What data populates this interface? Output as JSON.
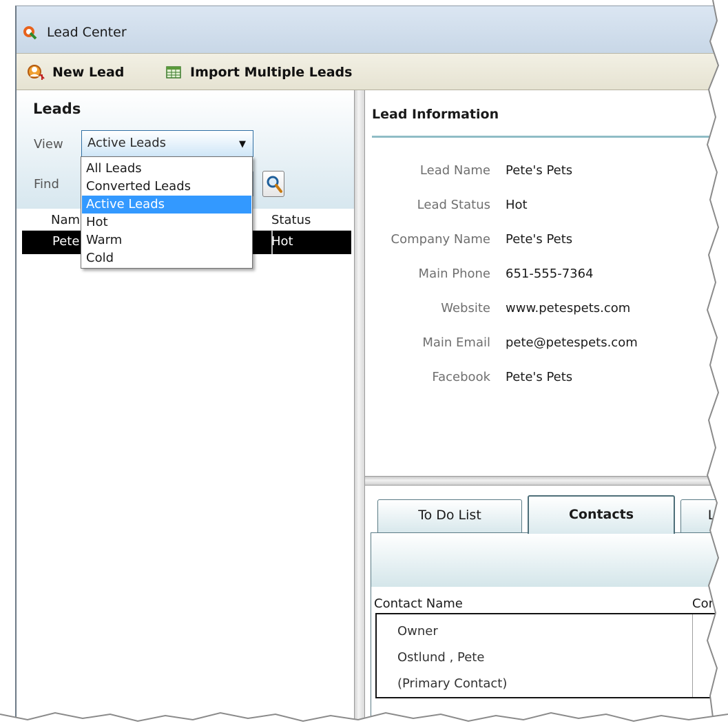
{
  "window": {
    "title": "Lead Center"
  },
  "toolbar": {
    "new_lead_label": "New Lead",
    "new_lead_icon": "new-lead-icon",
    "import_label": "Import Multiple Leads",
    "import_icon": "spreadsheet-icon"
  },
  "leads_panel": {
    "title": "Leads",
    "view_label": "View",
    "view_selected": "Active Leads",
    "find_label": "Find",
    "find_value": "",
    "dropdown_options": [
      "All Leads",
      "Converted Leads",
      "Active Leads",
      "Hot",
      "Warm",
      "Cold"
    ],
    "selected_option_index": 2,
    "grid": {
      "columns": [
        "Nam",
        "Status"
      ],
      "rows": [
        {
          "name": "Pete",
          "status": "Hot"
        }
      ]
    }
  },
  "lead_info": {
    "title": "Lead Information",
    "fields": [
      {
        "label": "Lead Name",
        "value": "Pete's Pets"
      },
      {
        "label": "Lead Status",
        "value": "Hot"
      },
      {
        "label": "Company Name",
        "value": "Pete's Pets"
      },
      {
        "label": "Main Phone",
        "value": "651-555-7364"
      },
      {
        "label": "Website",
        "value": "www.petespets.com"
      },
      {
        "label": "Main Email",
        "value": "pete@petespets.com"
      },
      {
        "label": "Facebook",
        "value": "Pete's Pets"
      }
    ]
  },
  "tabs": {
    "items": [
      "To Do List",
      "Contacts",
      "L"
    ],
    "active": "Contacts"
  },
  "contacts": {
    "columns": [
      "Contact Name",
      "Cor"
    ],
    "entry_lines": [
      "Owner",
      "Ostlund , Pete",
      "(Primary Contact)"
    ]
  },
  "colors": {
    "selection_blue": "#3399ff",
    "selected_row": "#000000",
    "panel_gradient": "#d7e7ef",
    "toolbar_bg": "#ece9d8"
  }
}
